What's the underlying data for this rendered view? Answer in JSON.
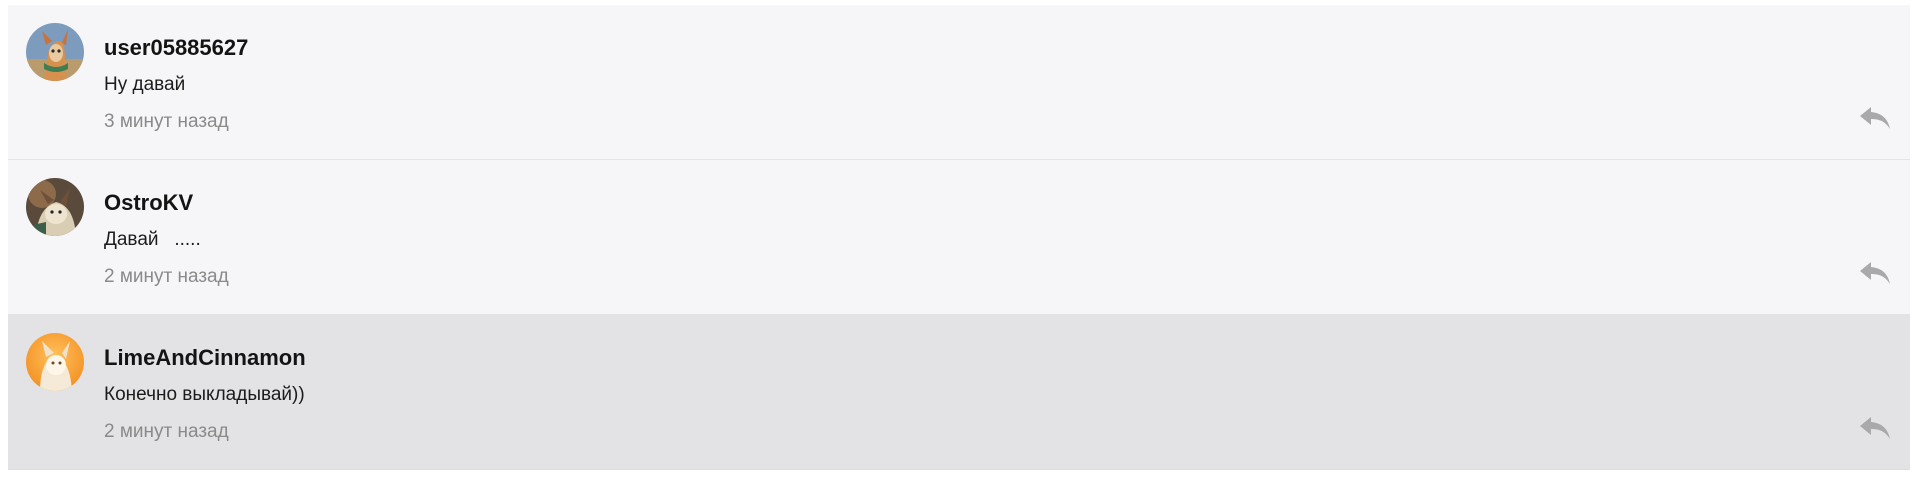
{
  "comments": [
    {
      "username": "user05885627",
      "text": "Ну давай",
      "time": "3 минут назад",
      "avatar_icon": "avatar-cartoon-character-icon",
      "highlighted": false
    },
    {
      "username": "OstroKV",
      "text": "Давай   .....",
      "time": "2 минут назад",
      "avatar_icon": "avatar-cartoon-character-icon",
      "highlighted": false
    },
    {
      "username": "LimeAndCinnamon",
      "text": "Конечно выкладывай))",
      "time": "2 минут назад",
      "avatar_icon": "avatar-cartoon-character-icon",
      "highlighted": true
    }
  ],
  "icons": {
    "reply": "reply-arrow-icon"
  },
  "colors": {
    "row_background": "#f6f5f8",
    "highlight_background": "#e3e2e5",
    "username": "#141414",
    "timestamp": "#8a8a8a",
    "reply_icon": "#a9a9ab"
  }
}
